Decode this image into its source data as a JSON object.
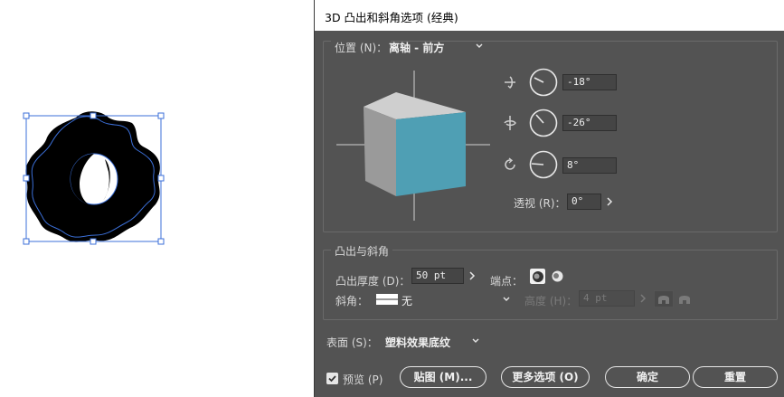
{
  "dialog": {
    "title": "3D 凸出和斜角选项 (经典)",
    "position": {
      "label": "位置 (N)：",
      "preset": "离轴 - 前方",
      "x_rotation": "-18°",
      "y_rotation": "-26°",
      "z_rotation": "8°",
      "perspective_label": "透视 (R)：",
      "perspective_value": "0°"
    },
    "extrude": {
      "legend": "凸出与斜角",
      "depth_label": "凸出厚度 (D)：",
      "depth_value": "50 pt",
      "cap_label": "端点：",
      "bevel_label": "斜角：",
      "bevel_value": "无",
      "height_label": "高度 (H)：",
      "height_value": "4 pt"
    },
    "surface": {
      "label": "表面 (S)：",
      "value": "塑料效果底纹"
    },
    "footer": {
      "preview_label": "预览 (P)",
      "map_button": "贴图 (M)...",
      "more_options_button": "更多选项 (O)",
      "ok_button": "确定",
      "reset_button": "重置"
    }
  },
  "colors": {
    "dialog_bg": "#535353",
    "cube_front": "#4f9fb4",
    "cube_top": "#cfcfcf",
    "cube_side": "#9a9a9a",
    "selection": "#3b6fd8"
  },
  "icons": [
    "dropdown-arrow-icon",
    "x-rotation-icon",
    "y-rotation-icon",
    "z-rotation-icon",
    "cap-on-icon",
    "cap-off-icon",
    "bevel-in-icon",
    "bevel-out-icon",
    "checkbox-checked-icon"
  ]
}
